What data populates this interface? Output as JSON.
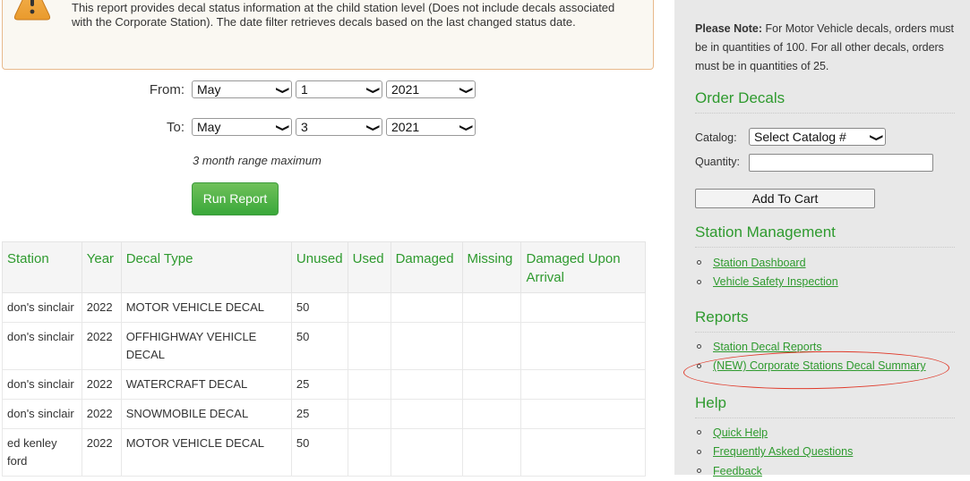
{
  "alert": {
    "icon": "warning-icon",
    "text": "This report provides decal status information at the child station level (Does not include decals associated with the Corporate Station). The date filter retrieves decals based on the last changed status date."
  },
  "date_filter": {
    "from_label": "From:",
    "to_label": "To:",
    "from": {
      "month": "May",
      "day": "1",
      "year": "2021"
    },
    "to": {
      "month": "May",
      "day": "3",
      "year": "2021"
    },
    "hint": "3 month range maximum",
    "run_button": "Run Report"
  },
  "table": {
    "headers": [
      "Station",
      "Year",
      "Decal Type",
      "Unused",
      "Used",
      "Damaged",
      "Missing",
      "Damaged Upon Arrival"
    ],
    "rows": [
      [
        "don's sinclair",
        "2022",
        "MOTOR VEHICLE DECAL",
        "50",
        "",
        "",
        "",
        ""
      ],
      [
        "don's sinclair",
        "2022",
        "OFFHIGHWAY VEHICLE DECAL",
        "50",
        "",
        "",
        "",
        ""
      ],
      [
        "don's sinclair",
        "2022",
        "WATERCRAFT DECAL",
        "25",
        "",
        "",
        "",
        ""
      ],
      [
        "don's sinclair",
        "2022",
        "SNOWMOBILE DECAL",
        "25",
        "",
        "",
        "",
        ""
      ],
      [
        "ed kenley ford",
        "2022",
        "MOTOR VEHICLE DECAL",
        "50",
        "",
        "",
        "",
        ""
      ]
    ]
  },
  "sidebar": {
    "note_bold": "Please Note:",
    "note_text": " For Motor Vehicle decals, orders must be in quantities of 100. For all other decals, orders must be in quantities of 25.",
    "order_heading": "Order Decals",
    "catalog_label": "Catalog:",
    "catalog_value": "Select Catalog #",
    "quantity_label": "Quantity:",
    "quantity_value": "",
    "add_to_cart": "Add To Cart",
    "station_mgmt_heading": "Station Management",
    "station_mgmt_links": [
      "Station Dashboard",
      "Vehicle Safety Inspection"
    ],
    "reports_heading": "Reports",
    "reports_links": [
      "Station Decal Reports",
      "(NEW) Corporate Stations Decal Summary"
    ],
    "help_heading": "Help",
    "help_links": [
      "Quick Help",
      "Frequently Asked Questions",
      "Feedback"
    ]
  },
  "annotation": {
    "highlight_color": "#e03a2a",
    "highlighted_item": "(NEW) Corporate Stations Decal Summary"
  }
}
